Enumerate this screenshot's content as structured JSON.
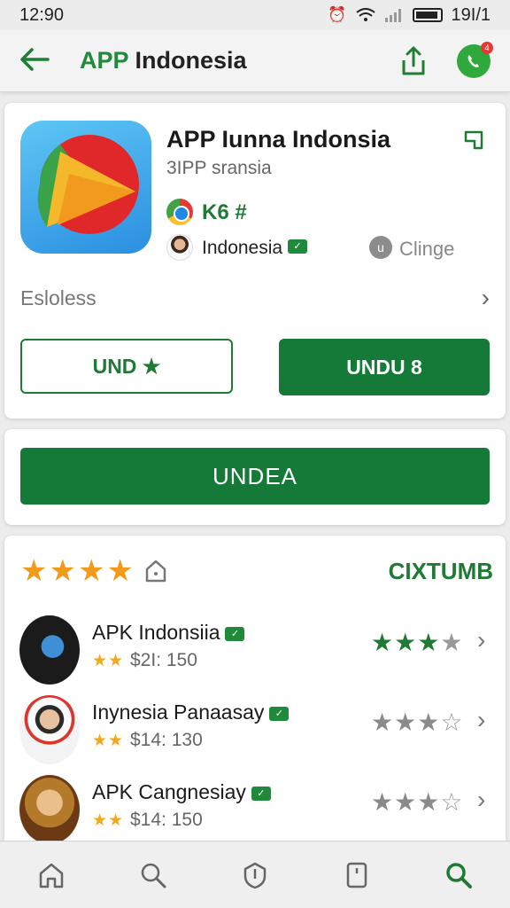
{
  "status_bar": {
    "time": "12:90",
    "right_text": "19I/1"
  },
  "app_bar": {
    "title_accent": "APP",
    "title_rest": " Indonesia"
  },
  "app_card": {
    "name": "APP Iunna Indonsia",
    "subtitle": "3IPP sransia",
    "chrome_label": "K6 #",
    "developer": "Indonesia",
    "clinge_label": "Clinge",
    "description_label": "Esloless",
    "button_outline_label": "UND ★",
    "button_solid_label": "UNDU 8"
  },
  "cta": {
    "main_button_label": "UNDEA"
  },
  "rating_section": {
    "stars": "★★★★",
    "action_label": "CIXTUMB",
    "rating_value": 4
  },
  "list": [
    {
      "title": "APK Indonsiia",
      "stars": "★★",
      "price": "$2I: 150",
      "rating": 3,
      "rating_style": "green"
    },
    {
      "title": "Inynesia Panaasay",
      "stars": "★★",
      "price": "$14: 130",
      "rating": 3,
      "rating_style": "gray"
    },
    {
      "title": "APK Cangnesiay",
      "stars": "★★",
      "price": "$14: 150",
      "rating": 3,
      "rating_style": "gray"
    }
  ],
  "colors": {
    "accent_green": "#1f7a34",
    "button_green": "#157a38",
    "star_orange": "#f29b1a"
  },
  "icons": [
    "back-arrow-icon",
    "share-icon",
    "whatsapp-icon",
    "bookmark-icon",
    "chrome-icon",
    "chevron-right-icon",
    "home-icon",
    "search-icon",
    "shield-icon",
    "tablet-icon"
  ]
}
